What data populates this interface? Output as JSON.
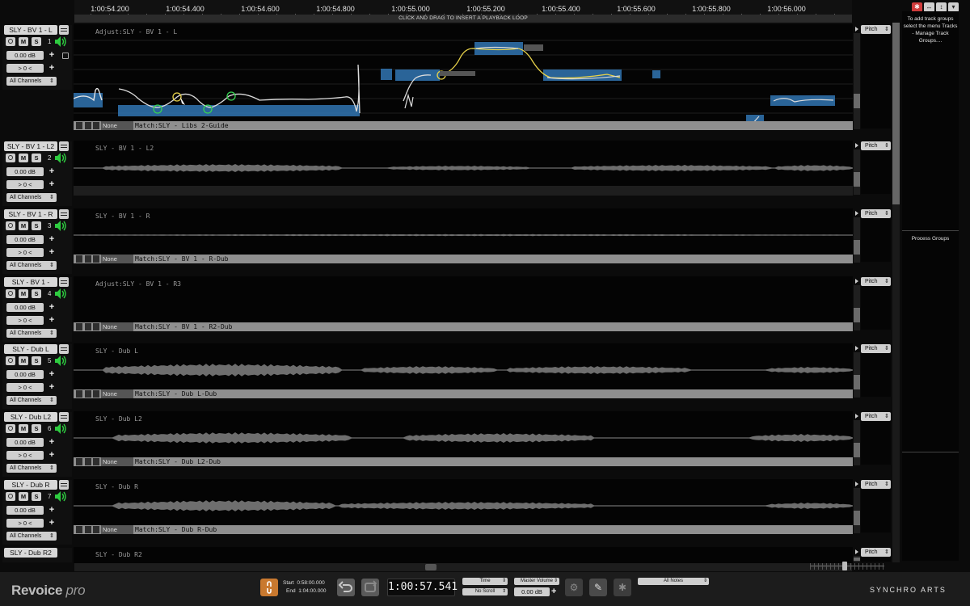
{
  "ruler": {
    "ticks": [
      "1:00:54.200",
      "1:00:54.400",
      "1:00:54.600",
      "1:00:54.800",
      "1:00:55.000",
      "1:00:55.200",
      "1:00:55.400",
      "1:00:55.600",
      "1:00:55.800",
      "1:00:56.000"
    ],
    "loop_hint": "CLICK AND DRAG TO INSERT A PLAYBACK LOOP"
  },
  "tracks": [
    {
      "name": "SLY - BV 1 - L",
      "num": "1",
      "gain": "0.00 dB",
      "pan": "> 0 <",
      "channels": "All Channels",
      "lane_title": "Adjust:SLY - BV 1 - L",
      "match_none": "None",
      "match": "Match:SLY - Libs 2-Guide",
      "pitch": "Pitch"
    },
    {
      "name": "SLY - BV 1 - L2",
      "num": "2",
      "gain": "0.00 dB",
      "pan": "> 0 <",
      "channels": "All Channels",
      "lane_title": "SLY - BV 1 - L2",
      "match_none": "",
      "match": "",
      "pitch": "Pitch"
    },
    {
      "name": "SLY - BV 1 - R",
      "num": "3",
      "gain": "0.00 dB",
      "pan": "> 0 <",
      "channels": "All Channels",
      "lane_title": "SLY - BV 1 - R",
      "match_none": "None",
      "match": "Match:SLY - BV 1 - R-Dub",
      "pitch": "Pitch"
    },
    {
      "name": "SLY - BV 1 -",
      "num": "4",
      "gain": "0.00 dB",
      "pan": "> 0 <",
      "channels": "All Channels",
      "lane_title": "Adjust:SLY - BV 1 - R3",
      "match_none": "None",
      "match": "Match:SLY - BV 1 - R2-Dub",
      "pitch": "Pitch"
    },
    {
      "name": "SLY - Dub L",
      "num": "5",
      "gain": "0.00 dB",
      "pan": "> 0 <",
      "channels": "All Channels",
      "lane_title": "SLY - Dub L",
      "match_none": "None",
      "match": "Match:SLY - Dub L-Dub",
      "pitch": "Pitch"
    },
    {
      "name": "SLY - Dub L2",
      "num": "6",
      "gain": "0.00 dB",
      "pan": "> 0 <",
      "channels": "All Channels",
      "lane_title": "SLY - Dub L2",
      "match_none": "None",
      "match": "Match:SLY - Dub L2-Dub",
      "pitch": "Pitch"
    },
    {
      "name": "SLY - Dub R",
      "num": "7",
      "gain": "0.00 dB",
      "pan": "> 0 <",
      "channels": "All Channels",
      "lane_title": "SLY - Dub R",
      "match_none": "None",
      "match": "Match:SLY - Dub R-Dub",
      "pitch": "Pitch"
    },
    {
      "name": "SLY - Dub R2",
      "num": "",
      "gain": "",
      "pan": "",
      "channels": "",
      "lane_title": "SLY - Dub R2",
      "match_none": "",
      "match": "",
      "pitch": "Pitch"
    }
  ],
  "buttons": {
    "record": "",
    "mute": "M",
    "solo": "S",
    "plus": "+"
  },
  "groups": {
    "help": "To add track groups select the menu Tracks - Manage Track Groups....",
    "process": "Process Groups"
  },
  "transport": {
    "logo_main": "Revoice",
    "logo_sub": "pro",
    "start_label": "Start",
    "start_value": "0:58:00.000",
    "end_label": "End",
    "end_value": "1:04:00.000",
    "time": "1:00:57.541",
    "mode": "Time",
    "scroll": "No Scroll",
    "master_label": "Master Volume",
    "master_value": "0.00 dB",
    "notes": "All Notes",
    "brand": "SYNCHRO ARTS"
  },
  "colors": {
    "accent_orange": "#c9792f",
    "pitch_blue": "#2f6fa8",
    "speaker_green": "#2ecc40",
    "node_green": "#39d353",
    "node_yellow": "#e8d24a"
  }
}
